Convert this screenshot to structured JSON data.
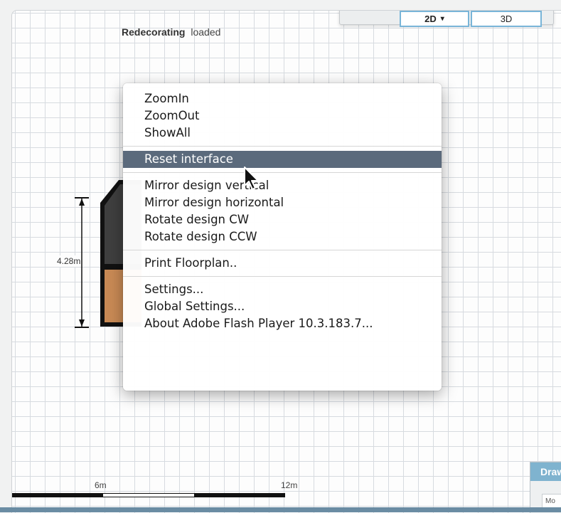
{
  "status": {
    "app_name": "Redecorating",
    "state": "loaded"
  },
  "view_switch": {
    "mode_2d": "2D",
    "mode_3d": "3D",
    "chevron_icon": "chevron-down-icon"
  },
  "floorplan": {
    "room_height_label": "4.28m",
    "wall_color": "#111111",
    "floor_color": "#c98a55",
    "carpet_color": "#3f3f3f"
  },
  "context_menu": {
    "group1": [
      "ZoomIn",
      "ZoomOut",
      "ShowAll"
    ],
    "group2": [
      "Reset interface"
    ],
    "group3": [
      "Mirror design vertical",
      "Mirror design horizontal",
      "Rotate design CW",
      "Rotate design CCW"
    ],
    "group4": [
      "Print Floorplan.."
    ],
    "group5": [
      "Settings...",
      "Global Settings...",
      "About Adobe Flash Player 10.3.183.7..."
    ],
    "highlighted_item": "Reset interface",
    "highlight_color": "#5b6a7c"
  },
  "scale_bar": {
    "mid_label": "6m",
    "end_label": "12m"
  },
  "side_panel": {
    "title": "Draw",
    "sub": "Mo"
  }
}
